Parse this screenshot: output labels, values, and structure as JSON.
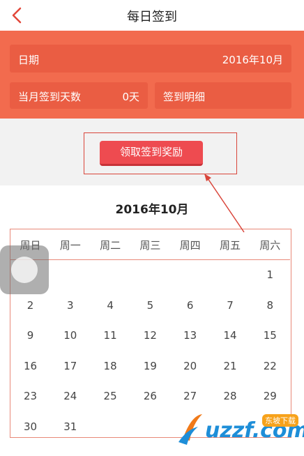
{
  "nav": {
    "title": "每日签到"
  },
  "header": {
    "date_label": "日期",
    "date_value": "2016年10月",
    "month_days_label": "当月签到天数",
    "month_days_value": "0天",
    "detail_label": "签到明细"
  },
  "reward": {
    "button_label": "领取签到奖励"
  },
  "calendar": {
    "month_title": "2016年10月",
    "weekdays": [
      "周日",
      "周一",
      "周二",
      "周三",
      "周四",
      "周五",
      "周六"
    ],
    "days": [
      "1",
      "2",
      "3",
      "4",
      "5",
      "6",
      "7",
      "8",
      "9",
      "10",
      "11",
      "12",
      "13",
      "14",
      "15",
      "16",
      "17",
      "18",
      "19",
      "20",
      "21",
      "22",
      "23",
      "24",
      "25",
      "26",
      "27",
      "28",
      "29",
      "30",
      "31"
    ],
    "first_weekday_index": 6
  },
  "watermark": {
    "text": "uzzf.com",
    "tag": "东坡下载"
  },
  "colors": {
    "header_bg": "#f26b4e",
    "button_bg": "#ee4b50",
    "annotation": "#d9453a"
  }
}
